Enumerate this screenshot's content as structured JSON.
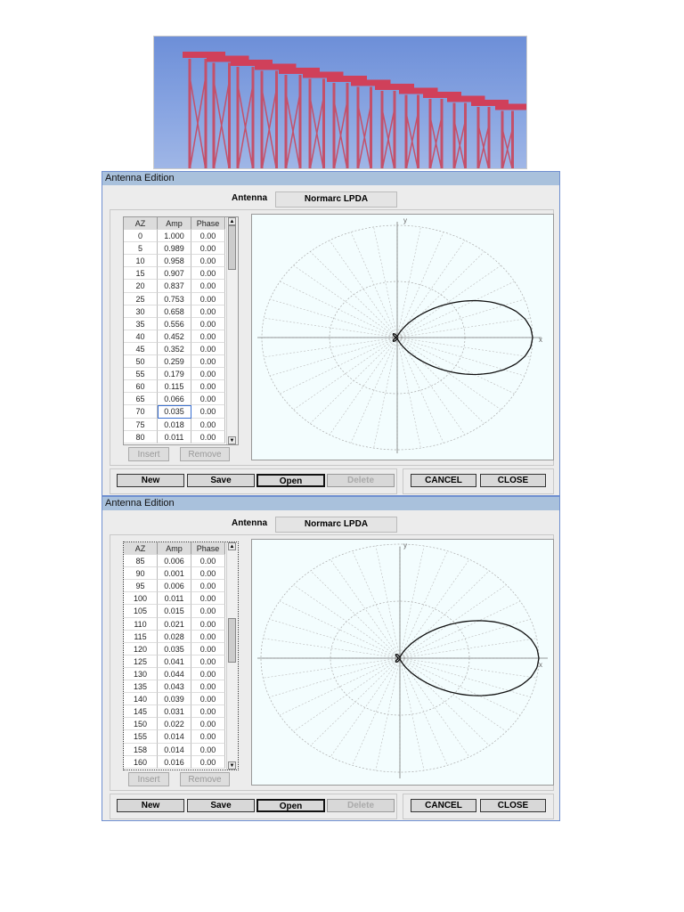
{
  "windows": [
    {
      "title": "Antenna Edition",
      "antenna_label": "Antenna",
      "antenna_name": "Normarc LPDA",
      "columns": [
        "AZ",
        "Amp",
        "Phase"
      ],
      "rows": [
        [
          "0",
          "1.000",
          "0.00"
        ],
        [
          "5",
          "0.989",
          "0.00"
        ],
        [
          "10",
          "0.958",
          "0.00"
        ],
        [
          "15",
          "0.907",
          "0.00"
        ],
        [
          "20",
          "0.837",
          "0.00"
        ],
        [
          "25",
          "0.753",
          "0.00"
        ],
        [
          "30",
          "0.658",
          "0.00"
        ],
        [
          "35",
          "0.556",
          "0.00"
        ],
        [
          "40",
          "0.452",
          "0.00"
        ],
        [
          "45",
          "0.352",
          "0.00"
        ],
        [
          "50",
          "0.259",
          "0.00"
        ],
        [
          "55",
          "0.179",
          "0.00"
        ],
        [
          "60",
          "0.115",
          "0.00"
        ],
        [
          "65",
          "0.066",
          "0.00"
        ],
        [
          "70",
          "0.035",
          "0.00"
        ],
        [
          "75",
          "0.018",
          "0.00"
        ],
        [
          "80",
          "0.011",
          "0.00"
        ]
      ],
      "insert": "Insert",
      "remove": "Remove",
      "new": "New",
      "save": "Save",
      "open": "Open",
      "delete": "Delete",
      "cancel": "CANCEL",
      "close": "CLOSE",
      "axis_x": "x",
      "axis_y": "y"
    },
    {
      "title": "Antenna Edition",
      "antenna_label": "Antenna",
      "antenna_name": "Normarc LPDA",
      "columns": [
        "AZ",
        "Amp",
        "Phase"
      ],
      "rows": [
        [
          "85",
          "0.006",
          "0.00"
        ],
        [
          "90",
          "0.001",
          "0.00"
        ],
        [
          "95",
          "0.006",
          "0.00"
        ],
        [
          "100",
          "0.011",
          "0.00"
        ],
        [
          "105",
          "0.015",
          "0.00"
        ],
        [
          "110",
          "0.021",
          "0.00"
        ],
        [
          "115",
          "0.028",
          "0.00"
        ],
        [
          "120",
          "0.035",
          "0.00"
        ],
        [
          "125",
          "0.041",
          "0.00"
        ],
        [
          "130",
          "0.044",
          "0.00"
        ],
        [
          "135",
          "0.043",
          "0.00"
        ],
        [
          "140",
          "0.039",
          "0.00"
        ],
        [
          "145",
          "0.031",
          "0.00"
        ],
        [
          "150",
          "0.022",
          "0.00"
        ],
        [
          "155",
          "0.014",
          "0.00"
        ],
        [
          "158",
          "0.014",
          "0.00"
        ],
        [
          "160",
          "0.016",
          "0.00"
        ]
      ],
      "insert": "Insert",
      "remove": "Remove",
      "new": "New",
      "save": "Save",
      "open": "Open",
      "delete": "Delete",
      "cancel": "CANCEL",
      "close": "CLOSE",
      "axis_x": "x",
      "axis_y": "y"
    }
  ]
}
